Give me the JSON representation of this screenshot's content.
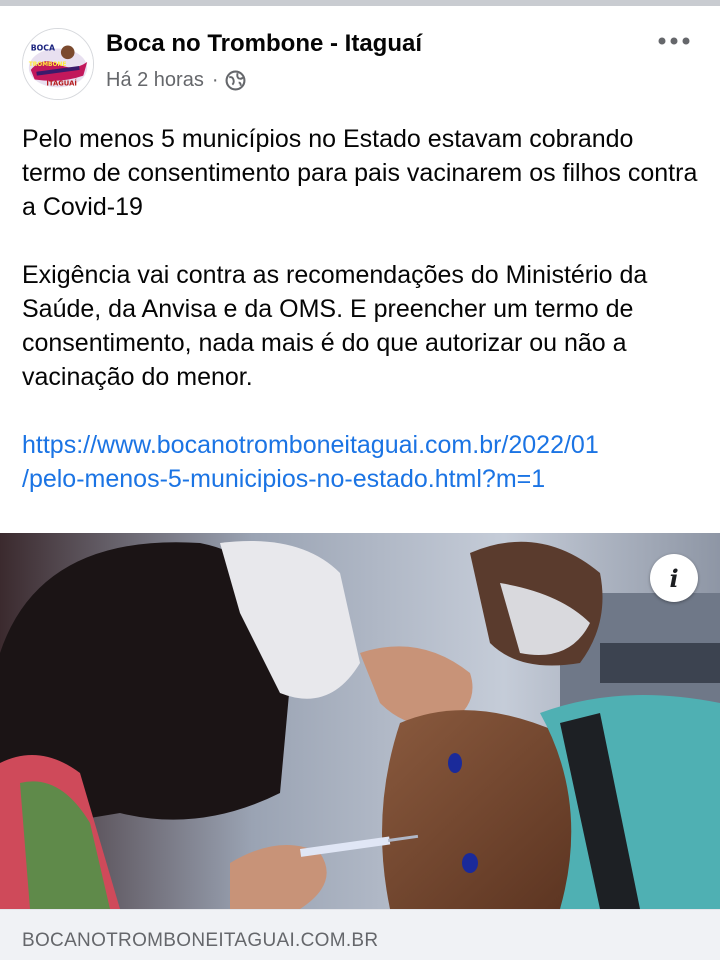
{
  "post": {
    "page_name": "Boca no Trombone - Itaguaí",
    "timestamp": "Há 2 horas",
    "separator": "·",
    "privacy_icon": "globe-icon",
    "more_icon": "more-options-icon",
    "avatar_text": [
      "BOCA",
      "TROMBONE",
      "ITAGUAÍ"
    ],
    "paragraphs": [
      "Pelo menos 5 municípios no Estado estavam cobrando termo de consentimento para pais vacinarem os filhos contra a Covid-19",
      "Exigência vai contra as recomendações do Ministério da Saúde, da Anvisa e da OMS. E preencher um termo de consentimento, nada mais é do que autorizar ou não a vacinação do menor."
    ],
    "link_line1": "https://www.bocanotromboneitaguai.com.br/2022/01",
    "link_line2": "/pelo-menos-5-municipios-no-estado.html?m=1",
    "link_url": "https://www.bocanotromboneitaguai.com.br/2022/01/pelo-menos-5-municipios-no-estado.html?m=1"
  },
  "link_preview": {
    "info_icon_label": "i",
    "domain": "BOCANOTROMBONEITAGUAI.COM.BR"
  },
  "colors": {
    "link": "#1b74e4",
    "secondary_text": "#65676b",
    "footer_bg": "#f0f2f5"
  }
}
